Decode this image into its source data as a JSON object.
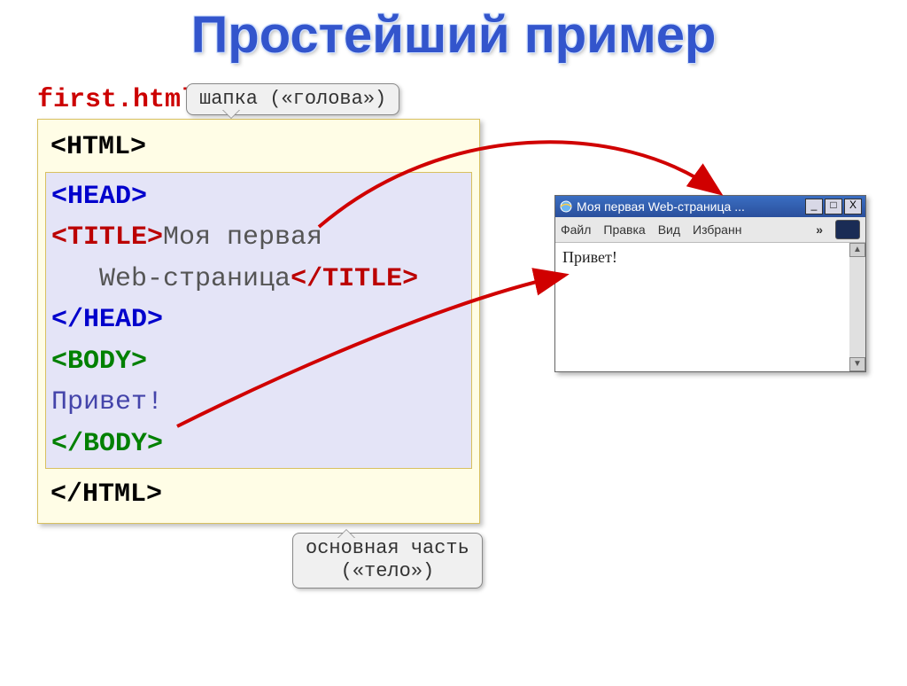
{
  "title": "Простейший пример",
  "filename": "first.html",
  "callout_head": "шапка («голова»)",
  "callout_body_line1": "основная часть",
  "callout_body_line2": "(«тело»)",
  "code": {
    "html_open": "<HTML>",
    "head_open": "<HEAD>",
    "title_open": "<TITLE>",
    "title_text1": "Моя первая",
    "title_text2": "Web-страница",
    "title_close": "</TITLE>",
    "head_close": "</HEAD>",
    "body_open": "<BODY>",
    "body_text": "Привет!",
    "body_close": "</BODY>",
    "html_close": "</HTML>"
  },
  "browser": {
    "title": "Моя первая Web-страница ...",
    "menu": {
      "file": "Файл",
      "edit": "Правка",
      "view": "Вид",
      "fav": "Избранн"
    },
    "chev": "»",
    "content": "Привет!",
    "min": "_",
    "max": "□",
    "close": "X",
    "up": "▲",
    "down": "▼"
  }
}
